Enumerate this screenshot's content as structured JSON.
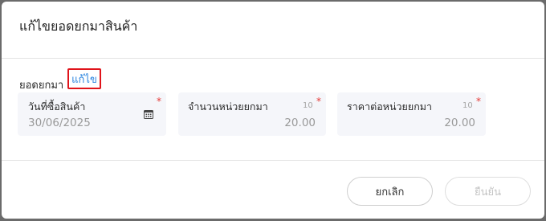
{
  "dialog": {
    "title": "แก้ไขยอดยกมาสินค้า"
  },
  "section": {
    "label": "ยอดยกมา",
    "edit_link": "แก้ไข"
  },
  "fields": [
    {
      "label": "วันที่ซื้อสินค้า",
      "value": "30/06/2025",
      "required_mark": "*",
      "icon": "calendar-icon"
    },
    {
      "label": "จำนวนหน่วยยกมา",
      "value": "20.00",
      "maxlen": "10",
      "required_mark": "*"
    },
    {
      "label": "ราคาต่อหน่วยยกมา",
      "value": "20.00",
      "maxlen": "10",
      "required_mark": "*"
    }
  ],
  "footer": {
    "cancel_label": "ยกเลิก",
    "confirm_label": "ยืนยัน"
  },
  "colors": {
    "accent_link": "#2d86e0",
    "highlight_border": "#e0141b",
    "required": "#e53935",
    "field_bg": "#f5f6fa"
  }
}
